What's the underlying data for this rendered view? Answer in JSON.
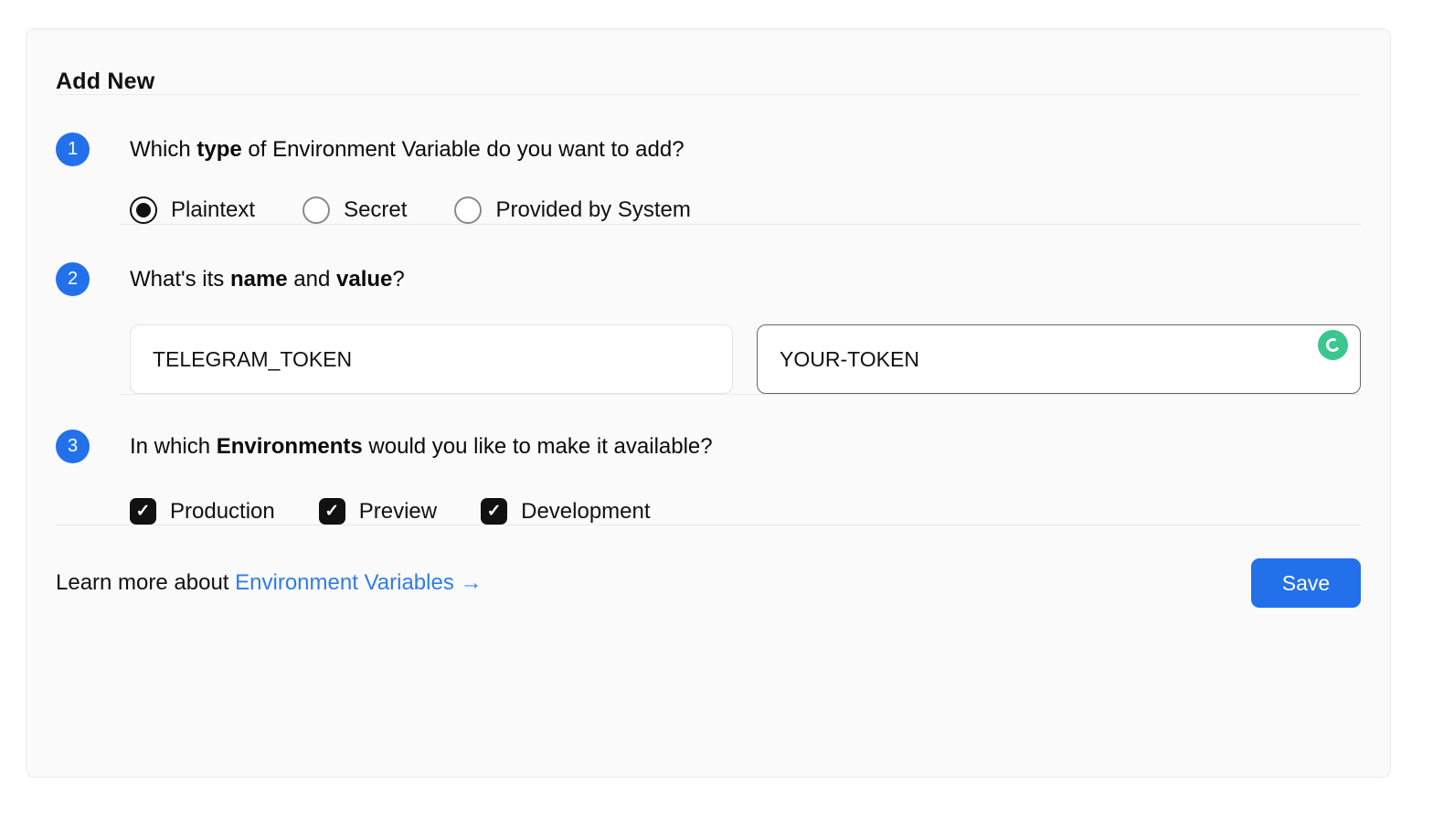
{
  "card": {
    "title": "Add New"
  },
  "steps": [
    {
      "number": "1",
      "question": [
        "Which ",
        "type",
        " of Environment Variable do you want to add?"
      ],
      "radios": [
        {
          "label": "Plaintext",
          "selected": true
        },
        {
          "label": "Secret",
          "selected": false
        },
        {
          "label": "Provided by System",
          "selected": false
        }
      ]
    },
    {
      "number": "2",
      "question": [
        "What's its ",
        "name",
        " and ",
        "value",
        "?"
      ],
      "fields": [
        {
          "role": "variable-name",
          "value": "TELEGRAM_TOKEN",
          "focused": false
        },
        {
          "role": "variable-value",
          "value": "YOUR-TOKEN",
          "focused": true,
          "status_icon": "loading-spinner"
        }
      ]
    },
    {
      "number": "3",
      "question": [
        "In which ",
        "Environments",
        " would you like to make it available?"
      ],
      "checkboxes": [
        {
          "label": "Production",
          "checked": true
        },
        {
          "label": "Preview",
          "checked": true
        },
        {
          "label": "Development",
          "checked": true
        }
      ]
    }
  ],
  "footer": {
    "learn_more_prefix": "Learn more about",
    "link_label": "Environment Variables",
    "link_arrow": "→",
    "save_label": "Save"
  },
  "glyphs": {
    "check": "✓"
  },
  "colors": {
    "accent_blue": "#2271eb",
    "link_blue": "#2f7de9",
    "spinner_green": "#3bc690",
    "checkbox_black": "#111111",
    "focused_input_border": "#666666",
    "card_background": "#fafafa",
    "card_border": "#ebebeb"
  }
}
